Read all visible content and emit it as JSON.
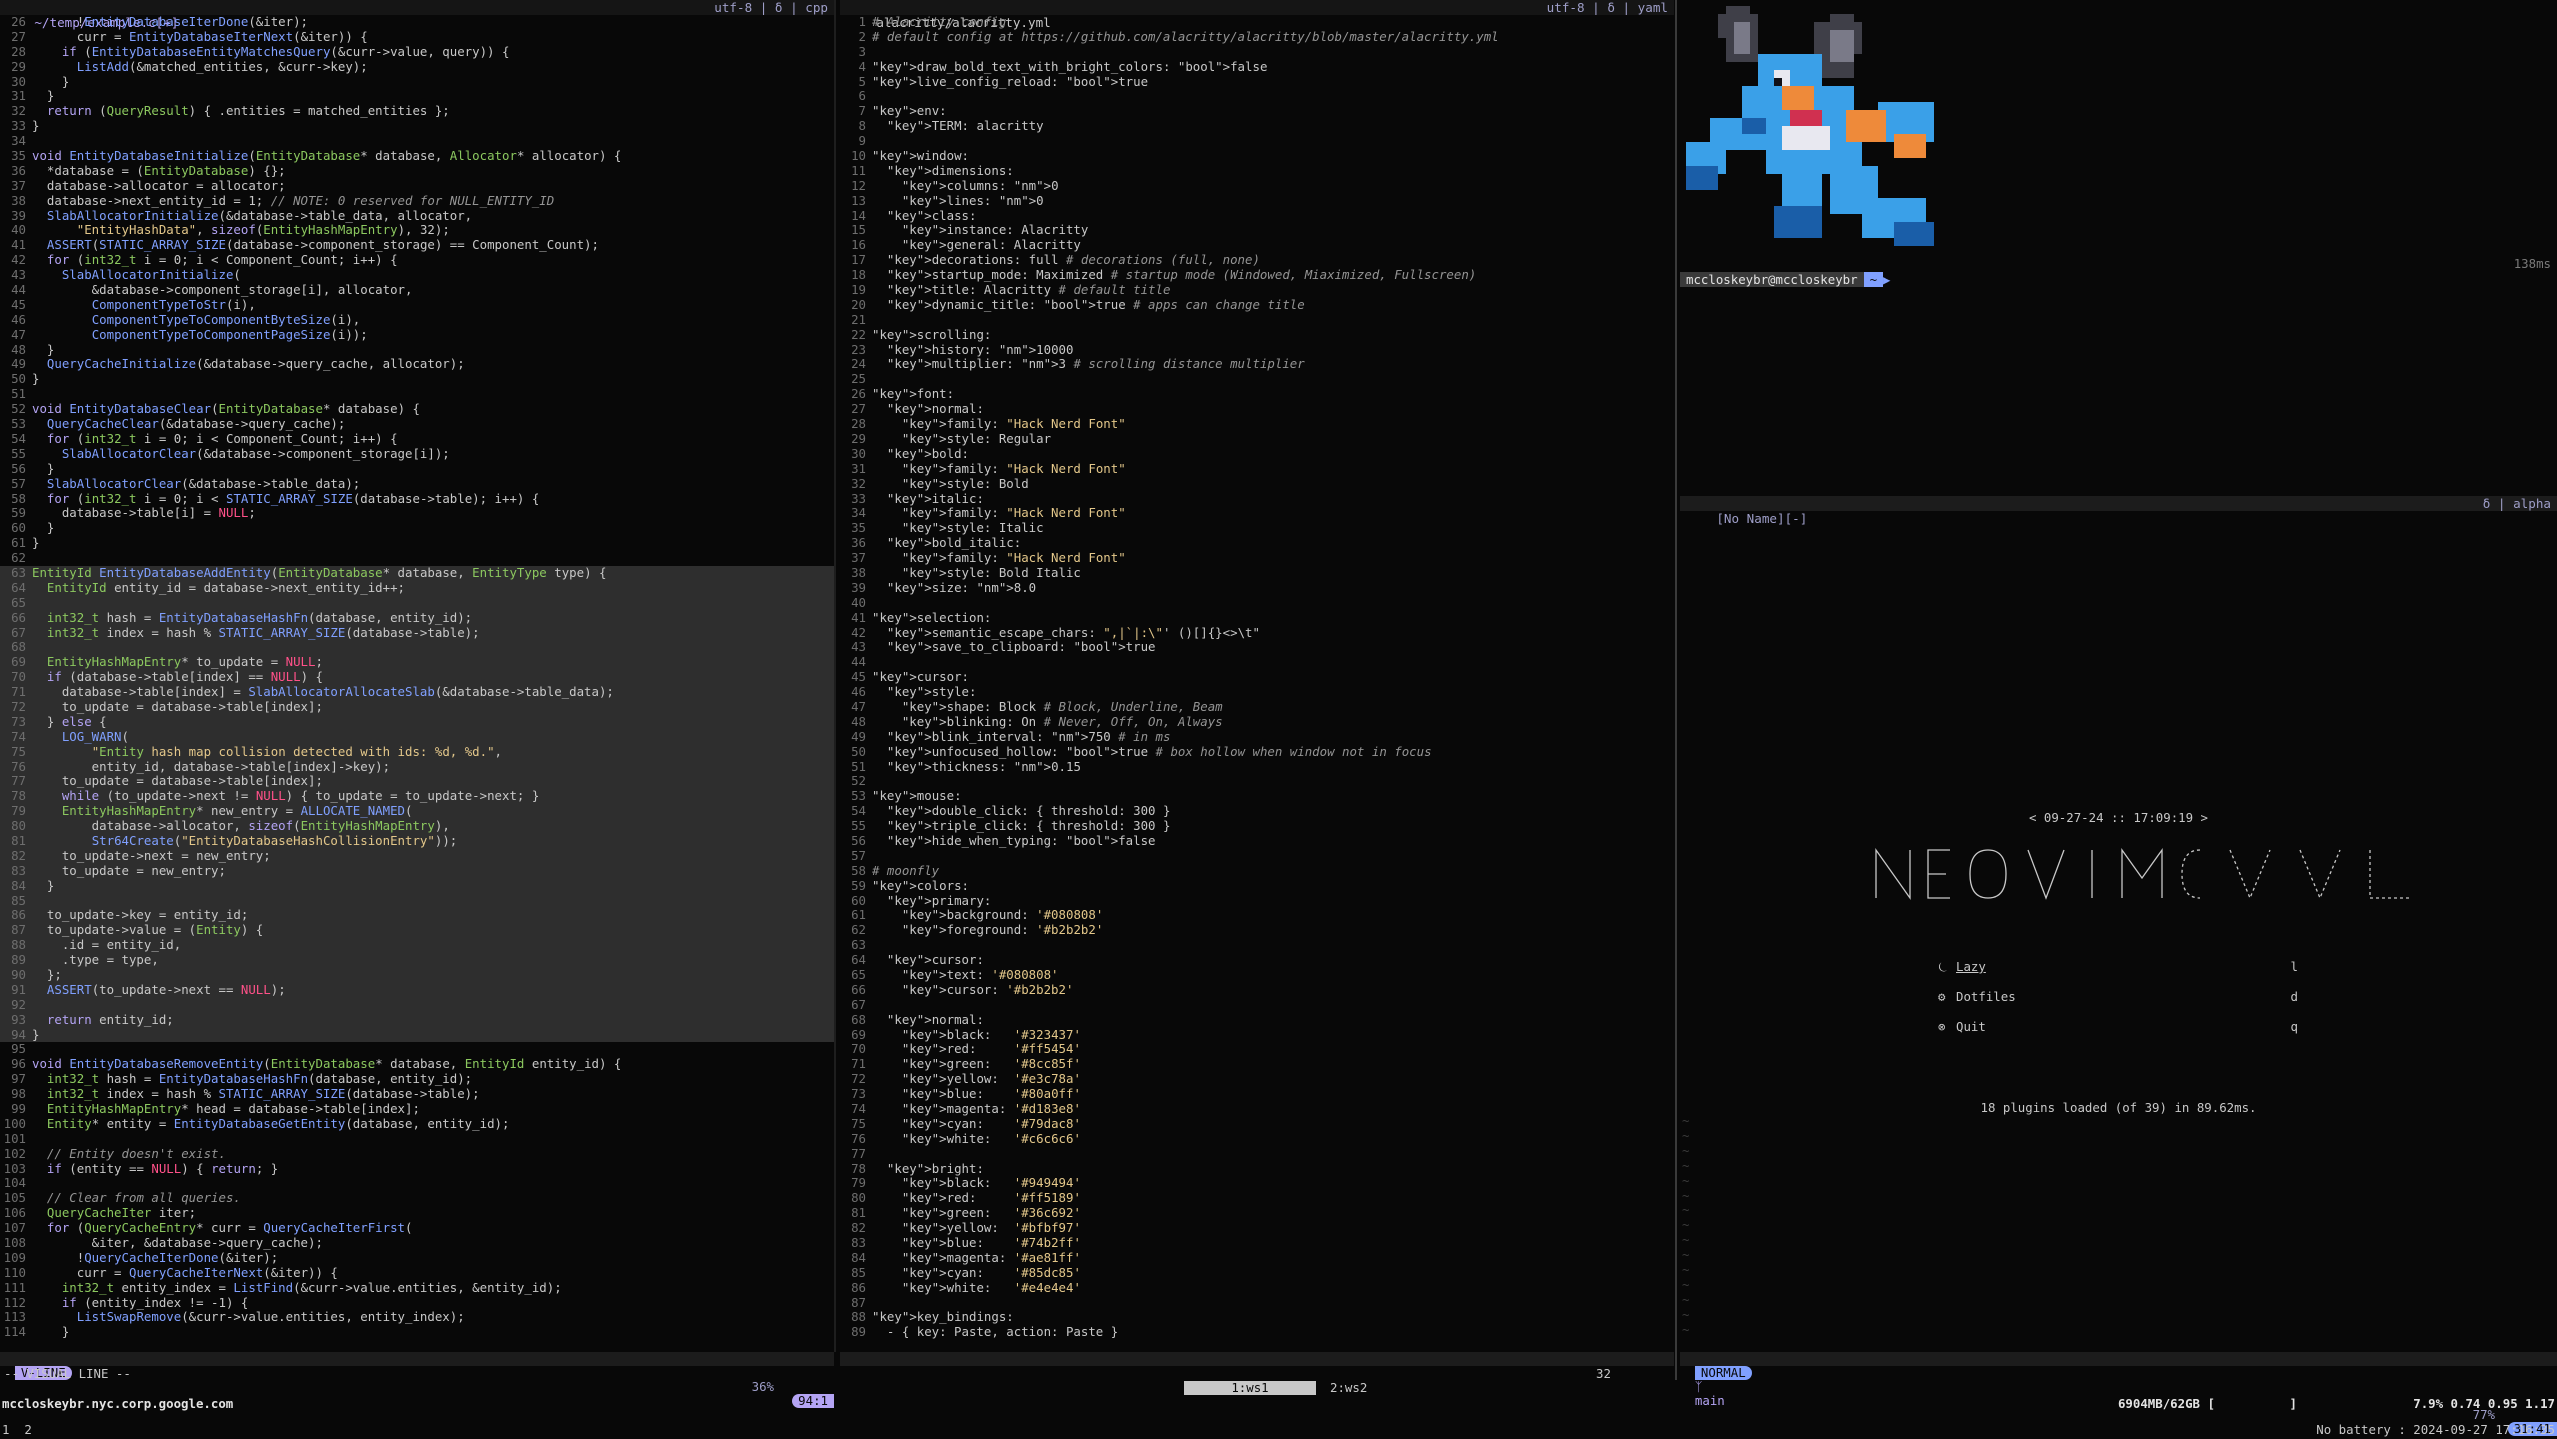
{
  "colors": {
    "bg": "#080808",
    "accent": "#b4a4f4",
    "green": "#8cc85f",
    "blue": "#80a0ff",
    "yellow": "#e3c78a",
    "red": "#ff5189"
  },
  "left_pane": {
    "header_title": "~/temp/example.c[+]",
    "header_right": "utf-8 | δ | cpp",
    "lines": [
      {
        "n": "26",
        "t": "      !EntityDatabaseIterDone(&iter);"
      },
      {
        "n": "27",
        "t": "      curr = EntityDatabaseIterNext(&iter)) {"
      },
      {
        "n": "28",
        "t": "    if (EntityDatabaseEntityMatchesQuery(&curr->value, query)) {"
      },
      {
        "n": "29",
        "t": "      ListAdd(&matched_entities, &curr->key);"
      },
      {
        "n": "30",
        "t": "    }"
      },
      {
        "n": "31",
        "t": "  }"
      },
      {
        "n": "32",
        "t": "  return (QueryResult) { .entities = matched_entities };"
      },
      {
        "n": "33",
        "t": "}"
      },
      {
        "n": "34",
        "t": ""
      },
      {
        "n": "35",
        "t": "void EntityDatabaseInitialize(EntityDatabase* database, Allocator* allocator) {"
      },
      {
        "n": "36",
        "t": "  *database = (EntityDatabase) {};"
      },
      {
        "n": "37",
        "t": "  database->allocator = allocator;"
      },
      {
        "n": "38",
        "t": "  database->next_entity_id = 1; // NOTE: 0 reserved for NULL_ENTITY_ID"
      },
      {
        "n": "39",
        "t": "  SlabAllocatorInitialize(&database->table_data, allocator,"
      },
      {
        "n": "40",
        "t": "      \"EntityHashData\", sizeof(EntityHashMapEntry), 32);"
      },
      {
        "n": "41",
        "t": "  ASSERT(STATIC_ARRAY_SIZE(database->component_storage) == Component_Count);"
      },
      {
        "n": "42",
        "t": "  for (int32_t i = 0; i < Component_Count; i++) {"
      },
      {
        "n": "43",
        "t": "    SlabAllocatorInitialize("
      },
      {
        "n": "44",
        "t": "        &database->component_storage[i], allocator,"
      },
      {
        "n": "45",
        "t": "        ComponentTypeToStr(i),"
      },
      {
        "n": "46",
        "t": "        ComponentTypeToComponentByteSize(i),"
      },
      {
        "n": "47",
        "t": "        ComponentTypeToComponentPageSize(i));"
      },
      {
        "n": "48",
        "t": "  }"
      },
      {
        "n": "49",
        "t": "  QueryCacheInitialize(&database->query_cache, allocator);"
      },
      {
        "n": "50",
        "t": "}"
      },
      {
        "n": "51",
        "t": ""
      },
      {
        "n": "52",
        "t": "void EntityDatabaseClear(EntityDatabase* database) {"
      },
      {
        "n": "53",
        "t": "  QueryCacheClear(&database->query_cache);"
      },
      {
        "n": "54",
        "t": "  for (int32_t i = 0; i < Component_Count; i++) {"
      },
      {
        "n": "55",
        "t": "    SlabAllocatorClear(&database->component_storage[i]);"
      },
      {
        "n": "56",
        "t": "  }"
      },
      {
        "n": "57",
        "t": "  SlabAllocatorClear(&database->table_data);"
      },
      {
        "n": "58",
        "t": "  for (int32_t i = 0; i < STATIC_ARRAY_SIZE(database->table); i++) {"
      },
      {
        "n": "59",
        "t": "    database->table[i] = NULL;"
      },
      {
        "n": "60",
        "t": "  }"
      },
      {
        "n": "61",
        "t": "}"
      },
      {
        "n": "62",
        "t": ""
      },
      {
        "n": "63",
        "t": "EntityId EntityDatabaseAddEntity(EntityDatabase* database, EntityType type) {",
        "hl": true
      },
      {
        "n": "64",
        "t": "  EntityId entity_id = database->next_entity_id++;",
        "hl": true
      },
      {
        "n": "65",
        "t": "",
        "hl": true
      },
      {
        "n": "66",
        "t": "  int32_t hash = EntityDatabaseHashFn(database, entity_id);",
        "hl": true
      },
      {
        "n": "67",
        "t": "  int32_t index = hash % STATIC_ARRAY_SIZE(database->table);",
        "hl": true
      },
      {
        "n": "68",
        "t": "",
        "hl": true
      },
      {
        "n": "69",
        "t": "  EntityHashMapEntry* to_update = NULL;",
        "hl": true
      },
      {
        "n": "70",
        "t": "  if (database->table[index] == NULL) {",
        "hl": true
      },
      {
        "n": "71",
        "t": "    database->table[index] = SlabAllocatorAllocateSlab(&database->table_data);",
        "hl": true
      },
      {
        "n": "72",
        "t": "    to_update = database->table[index];",
        "hl": true
      },
      {
        "n": "73",
        "t": "  } else {",
        "hl": true
      },
      {
        "n": "74",
        "t": "    LOG_WARN(",
        "hl": true
      },
      {
        "n": "75",
        "t": "        \"Entity hash map collision detected with ids: %d, %d.\",",
        "hl": true
      },
      {
        "n": "76",
        "t": "        entity_id, database->table[index]->key);",
        "hl": true
      },
      {
        "n": "77",
        "t": "    to_update = database->table[index];",
        "hl": true
      },
      {
        "n": "78",
        "t": "    while (to_update->next != NULL) { to_update = to_update->next; }",
        "hl": true
      },
      {
        "n": "79",
        "t": "    EntityHashMapEntry* new_entry = ALLOCATE_NAMED(",
        "hl": true
      },
      {
        "n": "80",
        "t": "        database->allocator, sizeof(EntityHashMapEntry),",
        "hl": true
      },
      {
        "n": "81",
        "t": "        Str64Create(\"EntityDatabaseHashCollisionEntry\"));",
        "hl": true
      },
      {
        "n": "82",
        "t": "    to_update->next = new_entry;",
        "hl": true
      },
      {
        "n": "83",
        "t": "    to_update = new_entry;",
        "hl": true
      },
      {
        "n": "84",
        "t": "  }",
        "hl": true
      },
      {
        "n": "85",
        "t": "",
        "hl": true
      },
      {
        "n": "86",
        "t": "  to_update->key = entity_id;",
        "hl": true
      },
      {
        "n": "87",
        "t": "  to_update->value = (Entity) {",
        "hl": true
      },
      {
        "n": "88",
        "t": "    .id = entity_id,",
        "hl": true
      },
      {
        "n": "89",
        "t": "    .type = type,",
        "hl": true
      },
      {
        "n": "90",
        "t": "  };",
        "hl": true
      },
      {
        "n": "91",
        "t": "  ASSERT(to_update->next == NULL);",
        "hl": true
      },
      {
        "n": "92",
        "t": "",
        "hl": true
      },
      {
        "n": "93",
        "t": "  return entity_id;",
        "hl": true
      },
      {
        "n": "94",
        "t": "}",
        "hl": true
      },
      {
        "n": "95",
        "t": ""
      },
      {
        "n": "96",
        "t": "void EntityDatabaseRemoveEntity(EntityDatabase* database, EntityId entity_id) {"
      },
      {
        "n": "97",
        "t": "  int32_t hash = EntityDatabaseHashFn(database, entity_id);"
      },
      {
        "n": "98",
        "t": "  int32_t index = hash % STATIC_ARRAY_SIZE(database->table);"
      },
      {
        "n": "99",
        "t": "  EntityHashMapEntry* head = database->table[index];"
      },
      {
        "n": "100",
        "t": "  Entity* entity = EntityDatabaseGetEntity(database, entity_id);"
      },
      {
        "n": "101",
        "t": ""
      },
      {
        "n": "102",
        "t": "  // Entity doesn't exist."
      },
      {
        "n": "103",
        "t": "  if (entity == NULL) { return; }"
      },
      {
        "n": "104",
        "t": ""
      },
      {
        "n": "105",
        "t": "  // Clear from all queries."
      },
      {
        "n": "106",
        "t": "  QueryCacheIter iter;"
      },
      {
        "n": "107",
        "t": "  for (QueryCacheEntry* curr = QueryCacheIterFirst("
      },
      {
        "n": "108",
        "t": "        &iter, &database->query_cache);"
      },
      {
        "n": "109",
        "t": "      !QueryCacheIterDone(&iter);"
      },
      {
        "n": "110",
        "t": "      curr = QueryCacheIterNext(&iter)) {"
      },
      {
        "n": "111",
        "t": "    int32_t entity_index = ListFind(&curr->value.entities, &entity_id);"
      },
      {
        "n": "112",
        "t": "    if (entity_index != -1) {"
      },
      {
        "n": "113",
        "t": "      ListSwapRemove(&curr->value.entities, entity_index);"
      },
      {
        "n": "114",
        "t": "    }"
      }
    ],
    "mode": "V-LINE",
    "percent": "36%",
    "position": "94:1"
  },
  "mid_pane": {
    "header_title": "alacritty/alacritty.yml",
    "header_right": "utf-8 | δ | yaml",
    "lines": [
      {
        "n": "1",
        "t": "# Alacritty config"
      },
      {
        "n": "2",
        "t": "# default config at https://github.com/alacritty/alacritty/blob/master/alacritty.yml"
      },
      {
        "n": "3",
        "t": ""
      },
      {
        "n": "4",
        "t": "draw_bold_text_with_bright_colors: false"
      },
      {
        "n": "5",
        "t": "live_config_reload: true"
      },
      {
        "n": "6",
        "t": ""
      },
      {
        "n": "7",
        "t": "env:"
      },
      {
        "n": "8",
        "t": "  TERM: alacritty"
      },
      {
        "n": "9",
        "t": ""
      },
      {
        "n": "10",
        "t": "window:"
      },
      {
        "n": "11",
        "t": "  dimensions:"
      },
      {
        "n": "12",
        "t": "    columns: 0"
      },
      {
        "n": "13",
        "t": "    lines: 0"
      },
      {
        "n": "14",
        "t": "  class:"
      },
      {
        "n": "15",
        "t": "    instance: Alacritty"
      },
      {
        "n": "16",
        "t": "    general: Alacritty"
      },
      {
        "n": "17",
        "t": "  decorations: full # decorations (full, none)"
      },
      {
        "n": "18",
        "t": "  startup_mode: Maximized # startup mode (Windowed, Miaximized, Fullscreen)"
      },
      {
        "n": "19",
        "t": "  title: Alacritty # default title"
      },
      {
        "n": "20",
        "t": "  dynamic_title: true # apps can change title"
      },
      {
        "n": "21",
        "t": ""
      },
      {
        "n": "22",
        "t": "scrolling:"
      },
      {
        "n": "23",
        "t": "  history: 10000"
      },
      {
        "n": "24",
        "t": "  multiplier: 3 # scrolling distance multiplier"
      },
      {
        "n": "25",
        "t": ""
      },
      {
        "n": "26",
        "t": "font:"
      },
      {
        "n": "27",
        "t": "  normal:"
      },
      {
        "n": "28",
        "t": "    family: \"Hack Nerd Font\""
      },
      {
        "n": "29",
        "t": "    style: Regular"
      },
      {
        "n": "30",
        "t": "  bold:"
      },
      {
        "n": "31",
        "t": "    family: \"Hack Nerd Font\""
      },
      {
        "n": "32",
        "t": "    style: Bold"
      },
      {
        "n": "33",
        "t": "  italic:"
      },
      {
        "n": "34",
        "t": "    family: \"Hack Nerd Font\""
      },
      {
        "n": "35",
        "t": "    style: Italic"
      },
      {
        "n": "36",
        "t": "  bold_italic:"
      },
      {
        "n": "37",
        "t": "    family: \"Hack Nerd Font\""
      },
      {
        "n": "38",
        "t": "    style: Bold Italic"
      },
      {
        "n": "39",
        "t": "  size: 8.0"
      },
      {
        "n": "40",
        "t": ""
      },
      {
        "n": "41",
        "t": "selection:"
      },
      {
        "n": "42",
        "t": "  semantic_escape_chars: \",|`|:\\\"' ()[]{}<>\\t\""
      },
      {
        "n": "43",
        "t": "  save_to_clipboard: true"
      },
      {
        "n": "44",
        "t": ""
      },
      {
        "n": "45",
        "t": "cursor:"
      },
      {
        "n": "46",
        "t": "  style:"
      },
      {
        "n": "47",
        "t": "    shape: Block # Block, Underline, Beam"
      },
      {
        "n": "48",
        "t": "    blinking: On # Never, Off, On, Always"
      },
      {
        "n": "49",
        "t": "  blink_interval: 750 # in ms"
      },
      {
        "n": "50",
        "t": "  unfocused_hollow: true # box hollow when window not in focus"
      },
      {
        "n": "51",
        "t": "  thickness: 0.15"
      },
      {
        "n": "52",
        "t": ""
      },
      {
        "n": "53",
        "t": "mouse:"
      },
      {
        "n": "54",
        "t": "  double_click: { threshold: 300 }"
      },
      {
        "n": "55",
        "t": "  triple_click: { threshold: 300 }"
      },
      {
        "n": "56",
        "t": "  hide_when_typing: false"
      },
      {
        "n": "57",
        "t": ""
      },
      {
        "n": "58",
        "t": "# moonfly"
      },
      {
        "n": "59",
        "t": "colors:"
      },
      {
        "n": "60",
        "t": "  primary:"
      },
      {
        "n": "61",
        "t": "    background: '#080808'"
      },
      {
        "n": "62",
        "t": "    foreground: '#b2b2b2'"
      },
      {
        "n": "63",
        "t": ""
      },
      {
        "n": "64",
        "t": "  cursor:"
      },
      {
        "n": "65",
        "t": "    text: '#080808'"
      },
      {
        "n": "66",
        "t": "    cursor: '#b2b2b2'"
      },
      {
        "n": "67",
        "t": ""
      },
      {
        "n": "68",
        "t": "  normal:"
      },
      {
        "n": "69",
        "t": "    black:   '#323437'"
      },
      {
        "n": "70",
        "t": "    red:     '#ff5454'"
      },
      {
        "n": "71",
        "t": "    green:   '#8cc85f'"
      },
      {
        "n": "72",
        "t": "    yellow:  '#e3c78a'"
      },
      {
        "n": "73",
        "t": "    blue:    '#80a0ff'"
      },
      {
        "n": "74",
        "t": "    magenta: '#d183e8'"
      },
      {
        "n": "75",
        "t": "    cyan:    '#79dac8'"
      },
      {
        "n": "76",
        "t": "    white:   '#c6c6c6'"
      },
      {
        "n": "77",
        "t": ""
      },
      {
        "n": "78",
        "t": "  bright:"
      },
      {
        "n": "79",
        "t": "    black:   '#949494'"
      },
      {
        "n": "80",
        "t": "    red:     '#ff5189'"
      },
      {
        "n": "81",
        "t": "    green:   '#36c692'"
      },
      {
        "n": "82",
        "t": "    yellow:  '#bfbf97'"
      },
      {
        "n": "83",
        "t": "    blue:    '#74b2ff'"
      },
      {
        "n": "84",
        "t": "    magenta: '#ae81ff'"
      },
      {
        "n": "85",
        "t": "    cyan:    '#85dc85'"
      },
      {
        "n": "86",
        "t": "    white:   '#e4e4e4'"
      },
      {
        "n": "87",
        "t": ""
      },
      {
        "n": "88",
        "t": "key_bindings:"
      },
      {
        "n": "89",
        "t": "  - { key: Paste, action: Paste }"
      }
    ]
  },
  "right_top": {
    "elapsed": "138ms",
    "prompt_user": "mccloskeybr@mccloskeybr",
    "prompt_arrow": "~"
  },
  "right_bottom": {
    "header_title": "[No Name][-]",
    "header_right": "δ | alpha",
    "datetime": "< 09-27-24  ::  17:09:19 >",
    "menu": [
      {
        "icon": "sleep-icon",
        "glyph": "⏾",
        "label": "Lazy",
        "key": "l"
      },
      {
        "icon": "gears-icon",
        "glyph": "⚙",
        "label": "Dotfiles",
        "key": "d"
      },
      {
        "icon": "quit-icon",
        "glyph": "⊗",
        "label": "Quit",
        "key": "q"
      }
    ],
    "plugins_text": "18 plugins loaded (of 39) in 89.62ms.",
    "mode": "NORMAL",
    "branch": "main",
    "percent": "77%",
    "position": "31:41"
  },
  "cmdline": {
    "text": "-- VISUAL LINE --",
    "count": "32"
  },
  "workspaces": [
    {
      "label": "1:ws1",
      "active": true
    },
    {
      "label": "2:ws2",
      "active": false
    }
  ],
  "statusbar": {
    "hostname": "mccloskeybr.nyc.corp.google.com",
    "memory": "6904MB/62GB [          ]",
    "load": "7.9% 0.74 0.95 1.17",
    "bottom_left": "1  2",
    "bottom_right": "No battery : 2024-09-27 17:16:35"
  }
}
